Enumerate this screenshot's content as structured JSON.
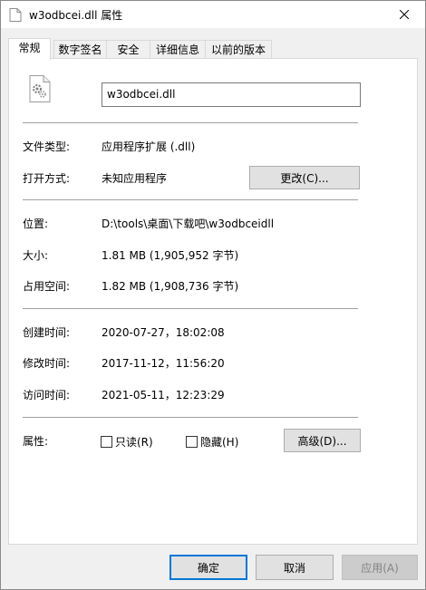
{
  "window": {
    "title": "w3odbcei.dll 属性"
  },
  "tabs": [
    {
      "label": "常规"
    },
    {
      "label": "数字签名"
    },
    {
      "label": "安全"
    },
    {
      "label": "详细信息"
    },
    {
      "label": "以前的版本"
    }
  ],
  "general": {
    "filename": "w3odbcei.dll",
    "type_label": "文件类型:",
    "type_value": "应用程序扩展 (.dll)",
    "opens_with_label": "打开方式:",
    "opens_with_value": "未知应用程序",
    "change_button": "更改(C)...",
    "location_label": "位置:",
    "location_value": "D:\\tools\\桌面\\下载吧\\w3odbceidll",
    "size_label": "大小:",
    "size_value": "1.81 MB (1,905,952 字节)",
    "size_on_disk_label": "占用空间:",
    "size_on_disk_value": "1.82 MB (1,908,736 字节)",
    "created_label": "创建时间:",
    "created_value": "2020-07-27，18:02:08",
    "modified_label": "修改时间:",
    "modified_value": "2017-11-12，11:56:20",
    "accessed_label": "访问时间:",
    "accessed_value": "2021-05-11，12:23:29",
    "attributes_label": "属性:",
    "readonly_label": "只读(R)",
    "hidden_label": "隐藏(H)",
    "advanced_button": "高级(D)..."
  },
  "footer": {
    "ok": "确定",
    "cancel": "取消",
    "apply": "应用(A)"
  },
  "colors": {
    "default_button_border": "#0078d7",
    "panel_bg": "#ffffff",
    "window_bg": "#f0f0f0"
  }
}
